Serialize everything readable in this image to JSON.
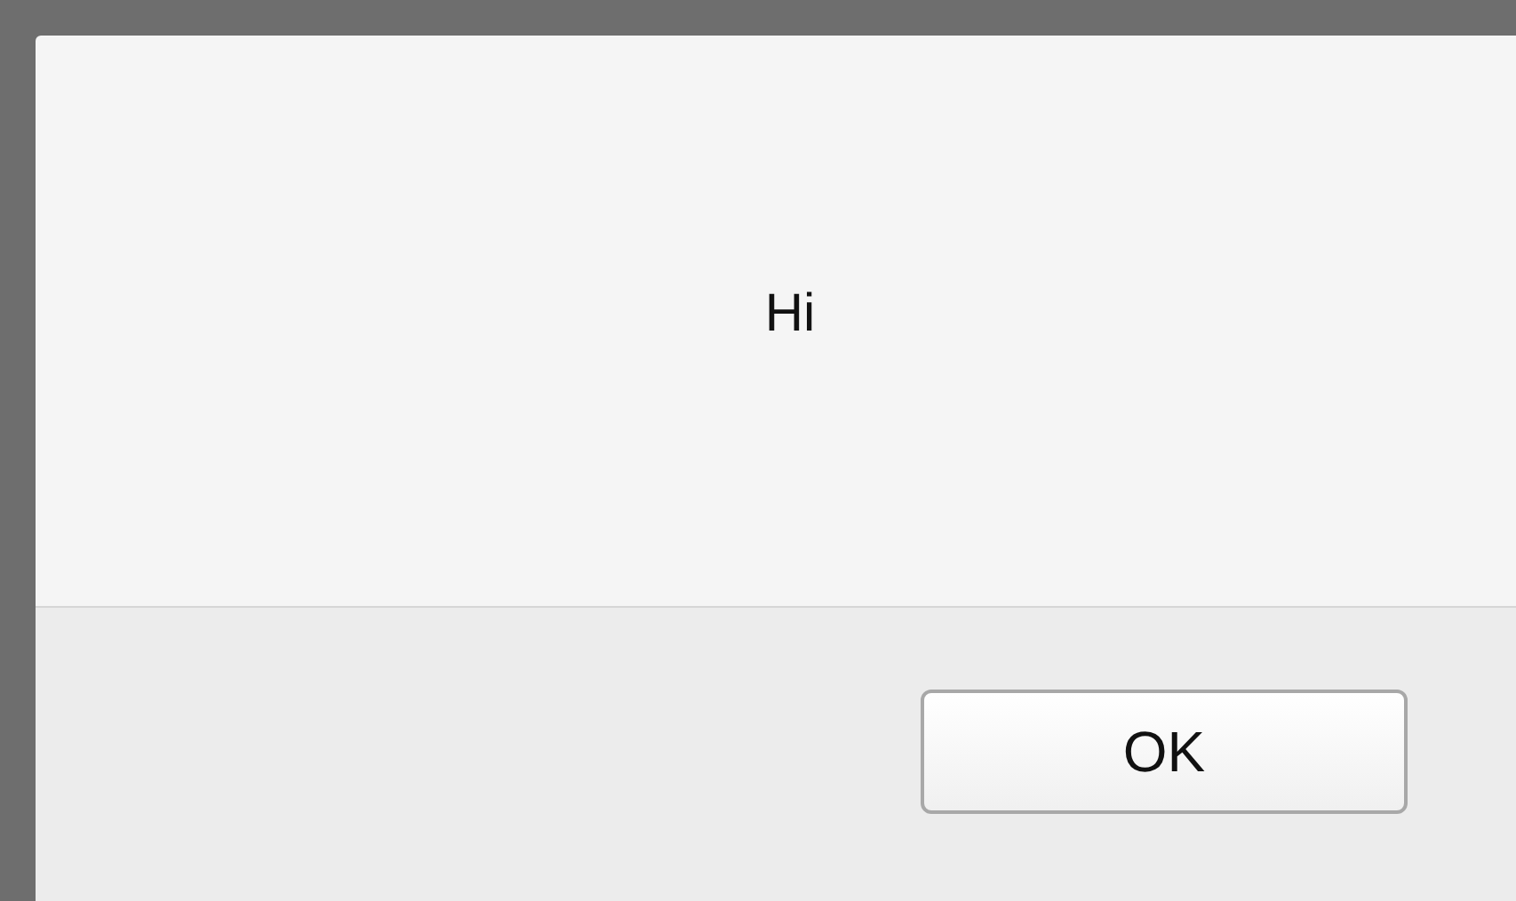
{
  "dialog": {
    "message": "Hi",
    "buttons": [
      "OK"
    ]
  }
}
